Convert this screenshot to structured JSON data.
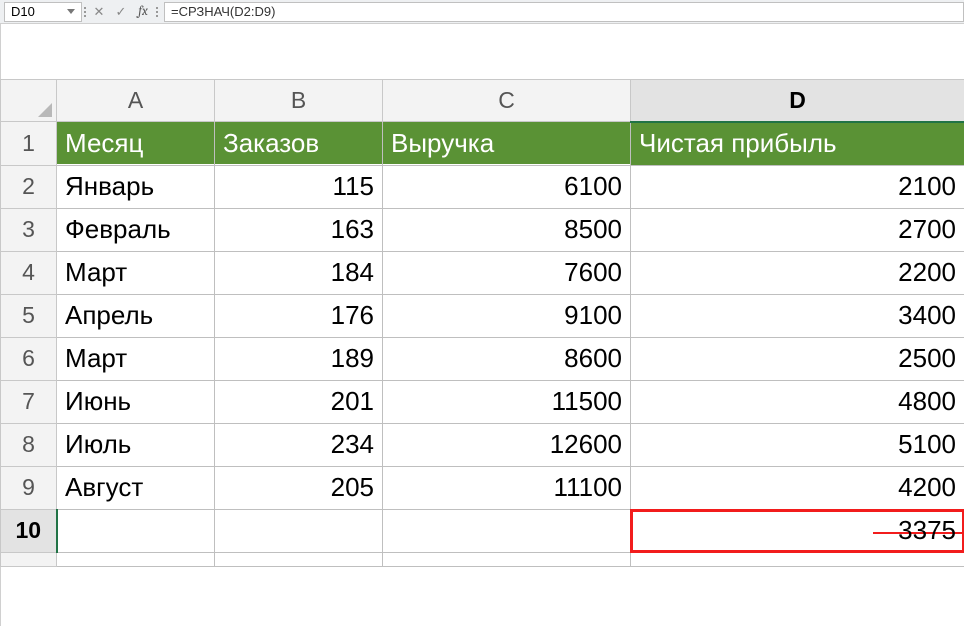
{
  "formulaBar": {
    "cellRef": "D10",
    "cancel": "✕",
    "enter": "✓",
    "fx": "fx",
    "formula": "=СРЗНАЧ(D2:D9)"
  },
  "columns": [
    "A",
    "B",
    "C",
    "D"
  ],
  "selectedCol": "D",
  "selectedRow": "10",
  "headers": {
    "A": "Месяц",
    "B": "Заказов",
    "C": "Выручка",
    "D": "Чистая прибыль"
  },
  "rows": [
    {
      "A": "Январь",
      "B": "115",
      "C": "6100",
      "D": "2100"
    },
    {
      "A": "Февраль",
      "B": "163",
      "C": "8500",
      "D": "2700"
    },
    {
      "A": "Март",
      "B": "184",
      "C": "7600",
      "D": "2200"
    },
    {
      "A": "Апрель",
      "B": "176",
      "C": "9100",
      "D": "3400"
    },
    {
      "A": "Март",
      "B": "189",
      "C": "8600",
      "D": "2500"
    },
    {
      "A": "Июнь",
      "B": "201",
      "C": "11500",
      "D": "4800"
    },
    {
      "A": "Июль",
      "B": "234",
      "C": "12600",
      "D": "5100"
    },
    {
      "A": "Август",
      "B": "205",
      "C": "11100",
      "D": "4200"
    }
  ],
  "resultCell": "3375",
  "chart_data": {
    "type": "table",
    "title": "",
    "columns": [
      "Месяц",
      "Заказов",
      "Выручка",
      "Чистая прибыль"
    ],
    "series": [
      {
        "name": "Заказов",
        "values": [
          115,
          163,
          184,
          176,
          189,
          201,
          234,
          205
        ]
      },
      {
        "name": "Выручка",
        "values": [
          6100,
          8500,
          7600,
          9100,
          8600,
          11500,
          12600,
          11100
        ]
      },
      {
        "name": "Чистая прибыль",
        "values": [
          2100,
          2700,
          2200,
          3400,
          2500,
          4800,
          5100,
          4200
        ]
      }
    ],
    "categories": [
      "Январь",
      "Февраль",
      "Март",
      "Апрель",
      "Март",
      "Июнь",
      "Июль",
      "Август"
    ],
    "aggregate": {
      "name": "СРЗНАЧ Чистая прибыль",
      "value": 3375
    }
  }
}
